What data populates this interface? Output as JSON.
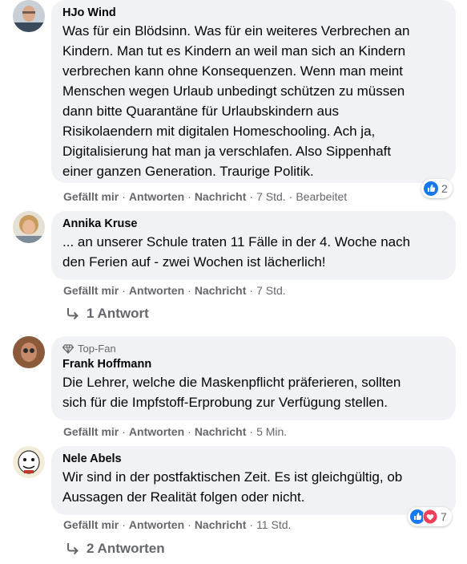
{
  "comments": [
    {
      "author": "HJo Wind",
      "text_lines": [
        "Was für ein Blödsinn. Was für ein weiteres Verbrechen an",
        "Kindern. Man tut es Kindern an weil man sich an Kindern",
        "verbrechen kann ohne Konsequenzen. Wenn man meint",
        "Menschen wegen Urlaub unbedingt schützen zu müssen",
        "dann bitte Quarantäne für Urlaubskindern aus",
        "Risikolaendern mit digitalen Homeschooling. Ach ja,",
        "Digitalisierung hat man ja verschlafen. Also Sippenhaft",
        "einer ganzen Generation. Traurige Politik."
      ],
      "actions": {
        "like": "Gefällt mir",
        "reply": "Antworten",
        "message": "Nachricht",
        "time": "7 Std.",
        "edited": "Bearbeitet"
      },
      "reaction_count": "2",
      "reaction_icons": [
        "like-icon"
      ]
    },
    {
      "author": "Annika Kruse",
      "text_lines": [
        "... an unserer Schule traten 11 Fälle in der 4. Woche nach",
        "den Ferien auf - zwei Wochen ist lächerlich!"
      ],
      "actions": {
        "like": "Gefällt mir",
        "reply": "Antworten",
        "message": "Nachricht",
        "time": "7 Std."
      },
      "replies_label": "1 Antwort"
    },
    {
      "badge": "Top-Fan",
      "author": "Frank Hoffmann",
      "text_lines": [
        "Die Lehrer, welche die Maskenpflicht präferieren, sollten",
        "sich für die Impfstoff-Erprobung zur Verfügung stellen."
      ],
      "actions": {
        "like": "Gefällt mir",
        "reply": "Antworten",
        "message": "Nachricht",
        "time": "5 Min."
      }
    },
    {
      "author": "Nele Abels",
      "text_lines": [
        "Wir sind in der postfaktischen Zeit. Es ist gleichgültig, ob",
        "Aussagen der Realität folgen oder nicht."
      ],
      "actions": {
        "like": "Gefällt mir",
        "reply": "Antworten",
        "message": "Nachricht",
        "time": "11 Std."
      },
      "reaction_count": "7",
      "reaction_icons": [
        "like-icon",
        "love-icon"
      ],
      "replies_label": "2 Antworten"
    }
  ],
  "colors": {
    "bubble": "#f0f2f5",
    "meta_text": "#65676b",
    "like_blue": "#1877f2",
    "love_red": "#f33e58"
  }
}
